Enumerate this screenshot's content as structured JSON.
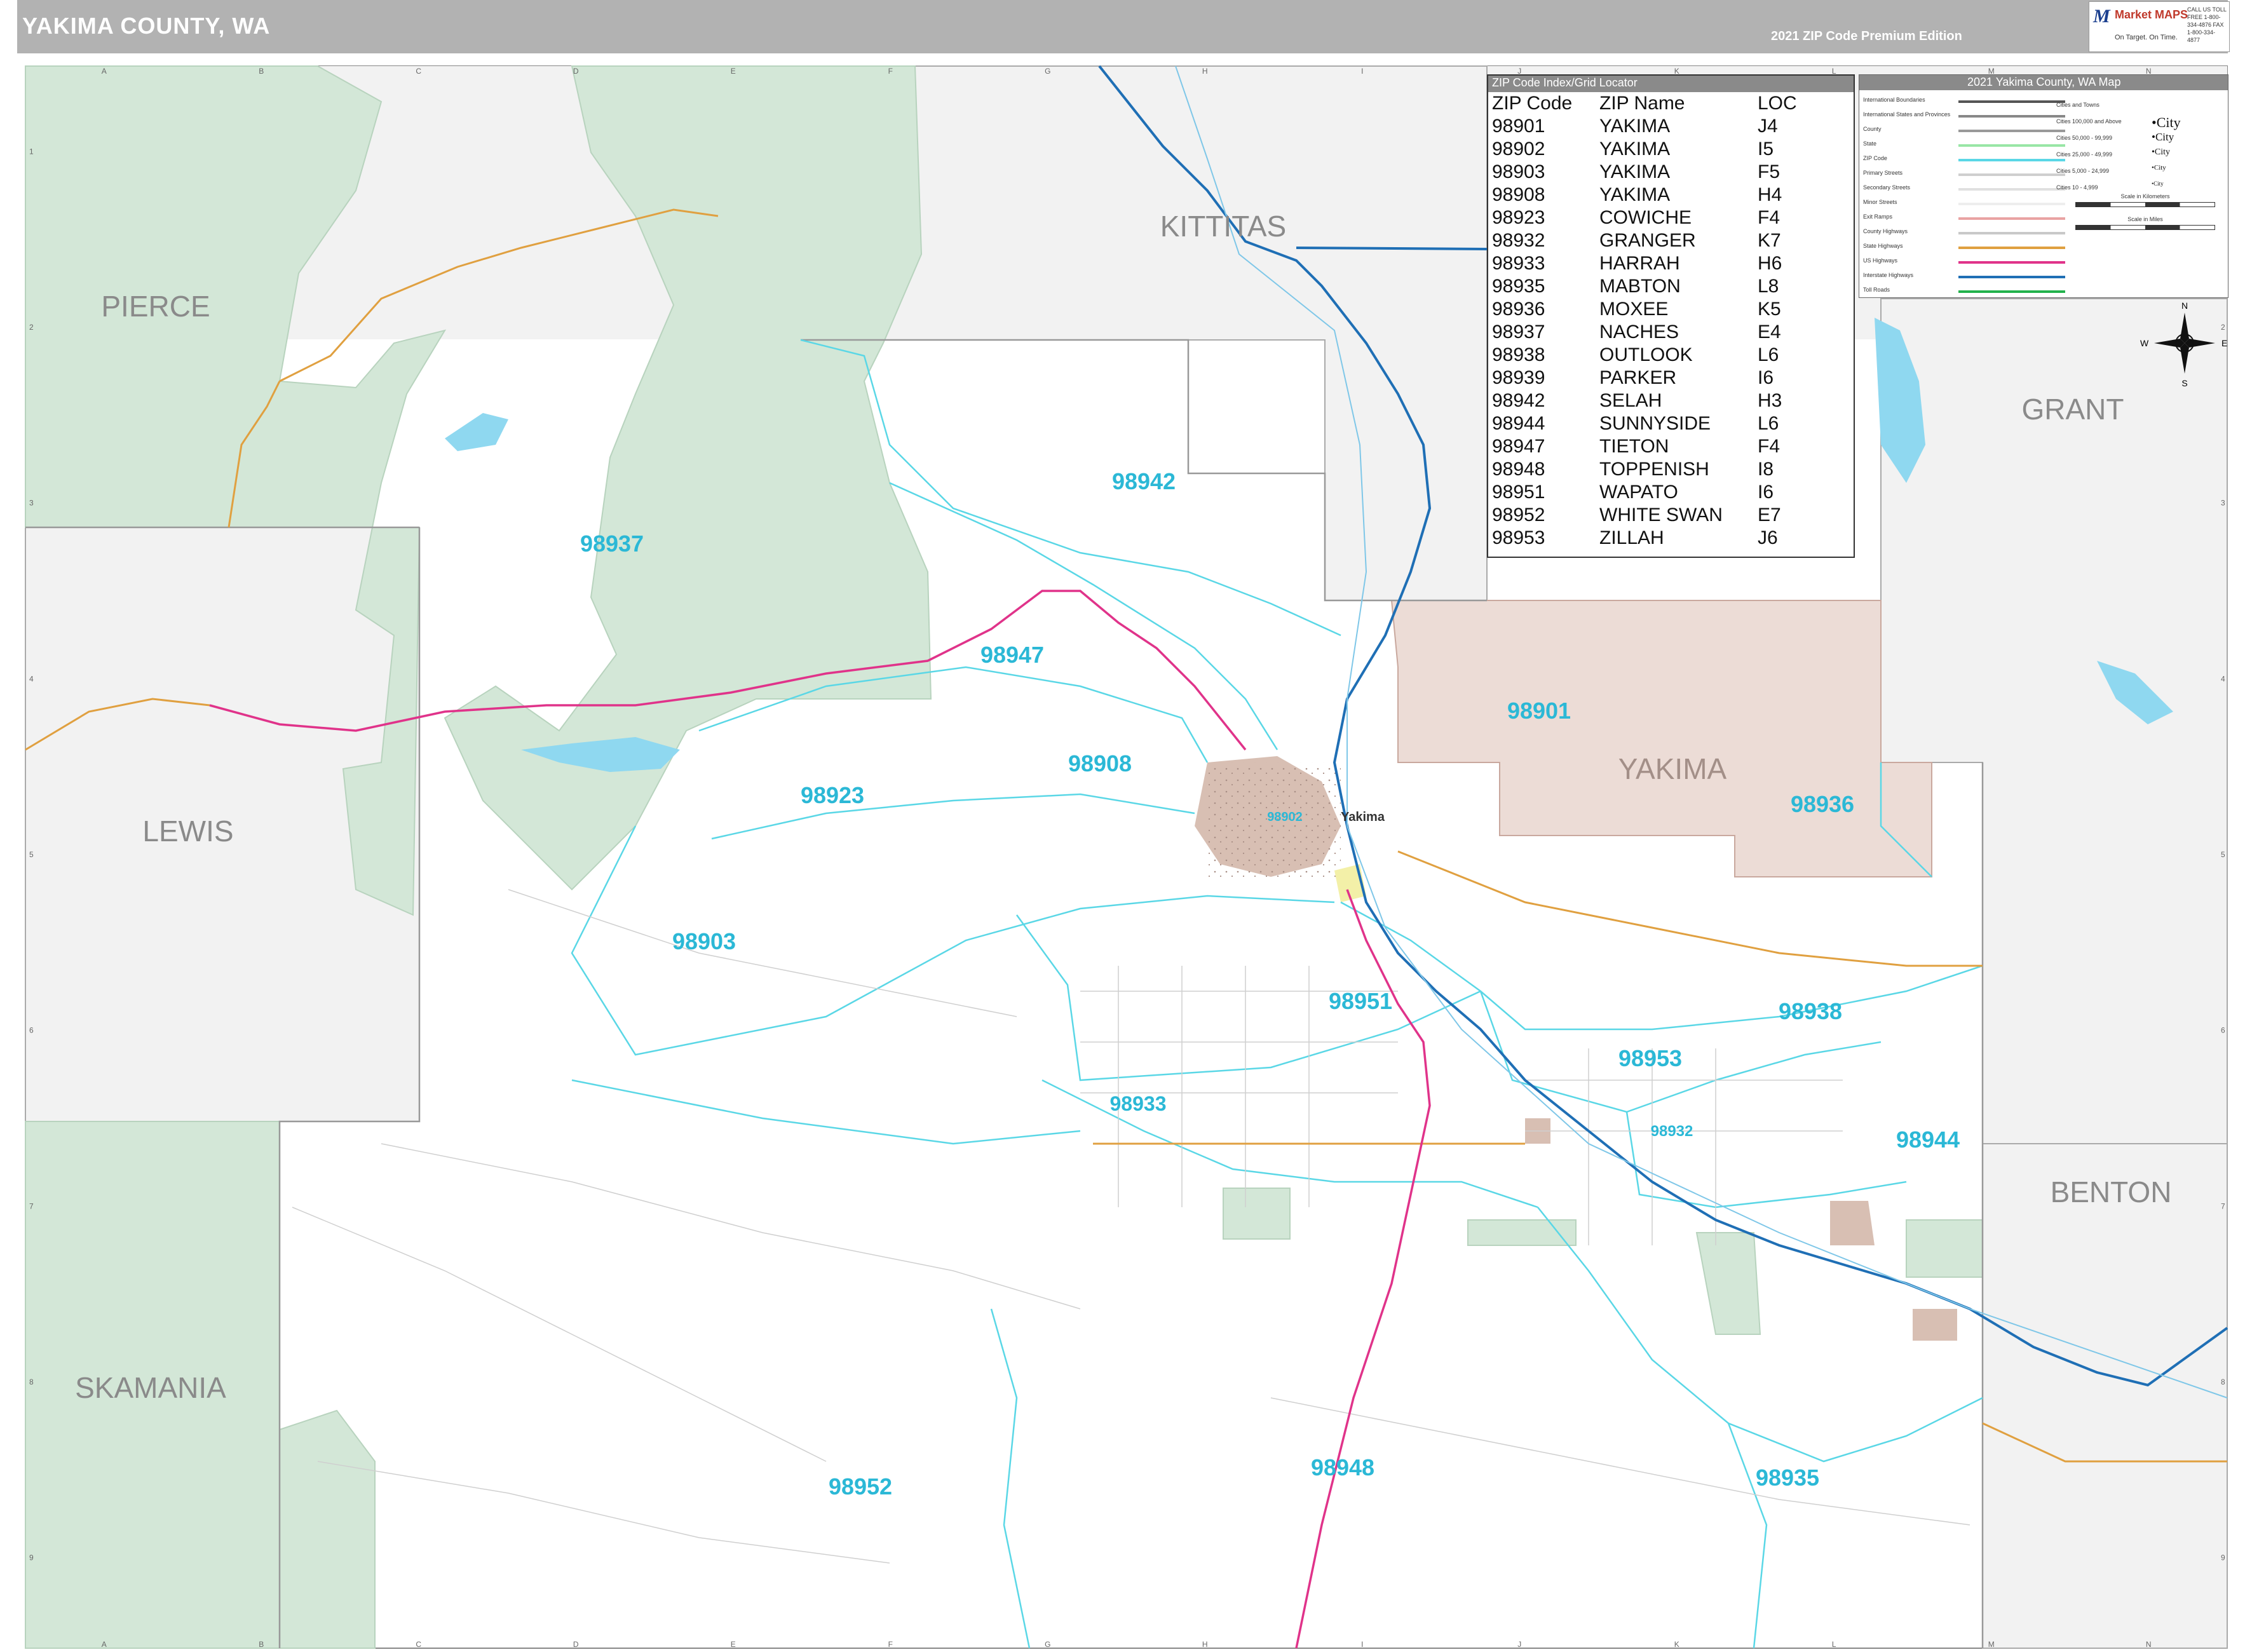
{
  "header": {
    "title": "YAKIMA COUNTY, WA",
    "edition": "2021 ZIP Code Premium Edition",
    "logo_brand": "Market MAPS",
    "logo_tagline": "On Target. On Time.",
    "logo_phone": "CALL US TOLL FREE 1-800-334-4876 FAX 1-800-334-4877"
  },
  "grid": {
    "columns": [
      "A",
      "B",
      "C",
      "D",
      "E",
      "F",
      "G",
      "H",
      "I",
      "J",
      "K",
      "L",
      "M",
      "N"
    ],
    "rows": [
      "1",
      "2",
      "3",
      "4",
      "5",
      "6",
      "7",
      "8",
      "9"
    ]
  },
  "counties": {
    "pierce": "PIERCE",
    "kittitas": "KITTITAS",
    "grant": "GRANT",
    "lewis": "LEWIS",
    "yakima": "YAKIMA",
    "benton": "BENTON",
    "skamania": "SKAMANIA"
  },
  "city_label": "Yakima",
  "zip_labels": {
    "z98942": "98942",
    "z98937": "98937",
    "z98947": "98947",
    "z98908": "98908",
    "z98901": "98901",
    "z98923": "98923",
    "z98936": "98936",
    "z98903": "98903",
    "z98951": "98951",
    "z98938": "98938",
    "z98953": "98953",
    "z98933": "98933",
    "z98932": "98932",
    "z98944": "98944",
    "z98948": "98948",
    "z98935": "98935",
    "z98952": "98952",
    "z98902": "98902"
  },
  "zip_index": {
    "title": "ZIP Code Index/Grid Locator",
    "headers": [
      "ZIP Code",
      "ZIP Name",
      "LOC"
    ],
    "rows": [
      [
        "98901",
        "YAKIMA",
        "J4"
      ],
      [
        "98902",
        "YAKIMA",
        "I5"
      ],
      [
        "98903",
        "YAKIMA",
        "F5"
      ],
      [
        "98908",
        "YAKIMA",
        "H4"
      ],
      [
        "98923",
        "COWICHE",
        "F4"
      ],
      [
        "98932",
        "GRANGER",
        "K7"
      ],
      [
        "98933",
        "HARRAH",
        "H6"
      ],
      [
        "98935",
        "MABTON",
        "L8"
      ],
      [
        "98936",
        "MOXEE",
        "K5"
      ],
      [
        "98937",
        "NACHES",
        "E4"
      ],
      [
        "98938",
        "OUTLOOK",
        "L6"
      ],
      [
        "98939",
        "PARKER",
        "I6"
      ],
      [
        "98942",
        "SELAH",
        "H3"
      ],
      [
        "98944",
        "SUNNYSIDE",
        "L6"
      ],
      [
        "98947",
        "TIETON",
        "F4"
      ],
      [
        "98948",
        "TOPPENISH",
        "I8"
      ],
      [
        "98951",
        "WAPATO",
        "I6"
      ],
      [
        "98952",
        "WHITE SWAN",
        "E7"
      ],
      [
        "98953",
        "ZILLAH",
        "J6"
      ]
    ]
  },
  "legend": {
    "title": "2021 Yakima County, WA Map",
    "items": [
      {
        "label": "International Boundaries",
        "color": "#555555"
      },
      {
        "label": "International States and Provinces",
        "color": "#888888"
      },
      {
        "label": "County",
        "color": "#999999"
      },
      {
        "label": "State",
        "color": "#99e6a6"
      },
      {
        "label": "ZIP Code",
        "color": "#5ad7e6"
      },
      {
        "label": "Primary Streets",
        "color": "#cfcfcf"
      },
      {
        "label": "Secondary Streets",
        "color": "#e0e0e0"
      },
      {
        "label": "Minor Streets",
        "color": "#eeeeee"
      },
      {
        "label": "Exit Ramps",
        "color": "#e9a3a3"
      },
      {
        "label": "County Highways",
        "color": "#c9c9c9"
      },
      {
        "label": "State Highways",
        "color": "#e0a040"
      },
      {
        "label": "US Highways",
        "color": "#e0338a"
      },
      {
        "label": "Interstate Highways",
        "color": "#1f6fb5"
      },
      {
        "label": "Toll Roads",
        "color": "#22b24c"
      }
    ],
    "cities_title": "Cities and Towns",
    "cities": [
      {
        "label": "Cities 100,000 and Above",
        "sample": "•City"
      },
      {
        "label": "Cities 50,000 - 99,999",
        "sample": "•City"
      },
      {
        "label": "Cities 25,000 - 49,999",
        "sample": "•City"
      },
      {
        "label": "Cities 5,000 - 24,999",
        "sample": "•City"
      },
      {
        "label": "Cities 10 - 4,999",
        "sample": "•City"
      }
    ],
    "scale_km": "Scale in Kilometers",
    "scale_mi": "Scale in Miles"
  },
  "colors": {
    "background": "#ffffff",
    "outside_county": "#f2f2f2",
    "forest": "#d3e7d7",
    "urban": "#e5d3cc",
    "zip_boundary": "#5ad7e6",
    "zip_label": "#2bb8d6",
    "county_label": "#8a8a8a",
    "interstate": "#1f6fb5",
    "us_highway": "#e0338a",
    "state_highway": "#e0a040",
    "water": "#8fd8f0"
  }
}
